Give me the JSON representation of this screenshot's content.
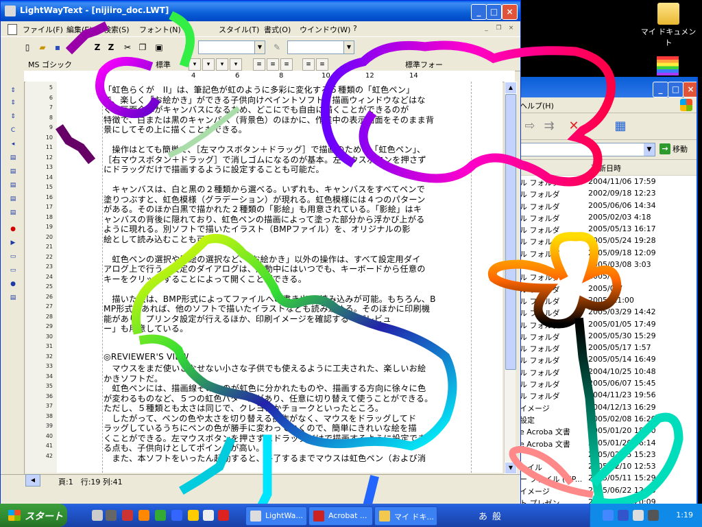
{
  "desktop": {
    "icons": [
      {
        "name": "my-documents",
        "label": "マイ ドキュメント",
        "icon": "folder-documents-icon"
      }
    ]
  },
  "editor": {
    "title": "LightWayText - [nijiiro_doc.LWT]",
    "menu": [
      "ファイル(F)",
      "編集(E)",
      "検索(S)",
      "フォント(N)",
      "",
      "スタイル(T)",
      "書式(O)",
      "ウインドウ(W)",
      "?"
    ],
    "toolbar2": {
      "font_name": "MS ゴシック",
      "style": "標準",
      "style_combo": "標準フォー"
    },
    "ruler_ticks": [
      "4",
      "6",
      "8",
      "10",
      "12",
      "14"
    ],
    "line_numbers": [
      "5",
      "6",
      "7",
      "8",
      "9",
      "10",
      "11",
      "12",
      "13",
      "14",
      "15",
      "16",
      "17",
      "18",
      "19",
      "20",
      "21",
      "22",
      "23",
      "24",
      "25",
      "26",
      "27",
      "28",
      "29",
      "30",
      "31",
      "32",
      "33",
      "34",
      "35",
      "36",
      "37",
      "38",
      "39",
      "40",
      "41",
      "42"
    ],
    "lines": [
      "「虹色らくが　II」は、筆記色が虹のように多彩に変化する５種類の「虹色ペン」",
      "で、楽しく「お絵かき」ができる子供向けペイントソフト。描画ウィンドウなどはな",
      "く、画面全体がキャンバスになるため、どこにでも自由に描くことができるのが",
      "特徴で、白または黒のキャンバス（背景色）のほかに、作業中の表示画面をそのまま背",
      "景にしてその上に描くこともできる。",
      "",
      "　操作はとても簡単で、［左マウスボタン＋ドラッグ］で描画のための「虹色ペン」、",
      "［右マウスボタン＋ドラッグ］で消しゴムになるのが基本。左マウスボタンを押さず",
      "にドラッグだけで描画するように設定することも可能だ。",
      "",
      "　キャンバスは、白と黒の２種類から選べる。いずれも、キャンバスをすべてペンで",
      "塗りつぶすと、虹色模様（グラデーション）が現れる。虹色模様には４つのパターン",
      "がある。そのほか白黒で描かれた２種類の「影絵」も用意されている。「影絵」はキ",
      "ャンバスの背後に隠れており、虹色ペンの描画によって塗った部分から浮かび上がる",
      "ように現れる。別ソフトで描いたイラスト（BMPファイル）を、オリジナルの影",
      "絵として読み込むことも可能だ。",
      "",
      "　虹色ペンの選択や影絵の選択など、「お絵かき」以外の操作は、すべて設定用ダイ",
      "アログ上で行う。設定のダイアログは、起動中にはいつでも、キーボードから任意の",
      "キーをクリックすることによって開くことができる。",
      "",
      "　描いた絵は、BMP形式によってファイルへの書き出し/読み込みが可能。もちろん、B",
      "MP形式であれば、他のソフトで描いたイラストなども読み込める。そのほかに印刷機",
      "能があり、プリンタ設定が行えるほか、印刷イメージを確認する「プレビュ",
      "ー」も用意している。",
      "",
      "",
      "◎REVIEWER'S VIEW",
      "　マウスをまだ使いこなせない小さな子供でも使えるように工夫された、楽しいお絵",
      "かきソフトだ。",
      "　虹色ペンには、描画線そのものが虹色に分かれたものや、描画する方向に徐々に色",
      "が変わるものなど、５つの虹色パターンがあり、任意に切り替えて使うことができる。",
      "ただし、５種類とも太さは同じで、クレヨンかチョークといったところ。",
      "　したがって、ペンの色や太さを切り替える操作がなく、マウスをドラッグしてド",
      "ラッグしているうちにペンの色が勝手に変わっていくので、簡単にきれいな絵を描",
      "くことができる。左マウスボタンを押さずにドラッグだけで描画するように設定でき",
      "る点も、子供向けとしてポイントが高い。",
      "　また、本ソフトをいったん起動すると、終了するまでマウスは虹色ペン（および消"
    ],
    "status": "頁:1　行:19 列:41"
  },
  "explorer": {
    "menu_help": "ヘルプ(H)",
    "go_label": "移動",
    "column_header": "更新日時",
    "rows": [
      {
        "type": "ル フォルダ",
        "date": "2004/11/06 17:59"
      },
      {
        "type": "ル フォルダ",
        "date": "2002/09/18 12:23"
      },
      {
        "type": "ル フォルダ",
        "date": "2005/06/06 14:34"
      },
      {
        "type": "ル フォルダ",
        "date": "2005/02/03 4:18"
      },
      {
        "type": "ル フォルダ",
        "date": "2005/05/13 16:17"
      },
      {
        "type": "ル フォルダ",
        "date": "2005/05/24 19:28"
      },
      {
        "type": "ル フォルダ",
        "date": "2005/09/18 12:09"
      },
      {
        "type": "",
        "date": "2005/03/08 3:03"
      },
      {
        "type": "ル フォルダ",
        "date": "2005/"
      },
      {
        "type": "ル フォルダ",
        "date": "2005/01/"
      },
      {
        "type": "ル フォルダ",
        "date": "2005/ 11:00"
      },
      {
        "type": "ル フォルダ",
        "date": "2005/03/29 14:42"
      },
      {
        "type": "ル フォルダ",
        "date": "2005/01/05 17:49"
      },
      {
        "type": "ル フォルダ",
        "date": "2005/05/30 15:29"
      },
      {
        "type": "ル フォルダ",
        "date": "2005/05/17 1:57"
      },
      {
        "type": "ル フォルダ",
        "date": "2005/05/14 16:49"
      },
      {
        "type": "ル フォルダ",
        "date": "2004/10/25 10:48"
      },
      {
        "type": "ル フォルダ",
        "date": "2005/06/07 15:45"
      },
      {
        "type": "ル フォルダ",
        "date": "2004/11/23 19:56"
      },
      {
        "type": "イメージ",
        "date": "2004/12/13 16:29"
      },
      {
        "type": "設定",
        "date": "2005/02/08 16:20"
      },
      {
        "type": "e Acroba 文書",
        "date": "2005/01/20 18:00"
      },
      {
        "type": "e Acroba 文書",
        "date": "2005/01/20 16:14"
      },
      {
        "type": "",
        "date": "2005/02/15 15:23"
      },
      {
        "type": "ァイル",
        "date": "2005/02/10 12:53"
      },
      {
        "type": "ー ファイル (MP...",
        "date": "2005/05/11 15:29"
      },
      {
        "type": "イメージ",
        "date": "2005/06/22 12:53"
      },
      {
        "type": "ト プレゼン...",
        "date": "2005/01/31 20:09"
      }
    ]
  },
  "taskbar": {
    "start_label": "スタート",
    "tasks": [
      {
        "label": "LightWa...",
        "icon": "lightway-icon"
      },
      {
        "label": "Acrobat ...",
        "icon": "acrobat-icon"
      },
      {
        "label": "マイ ドキ...",
        "icon": "folder-icon"
      }
    ],
    "ime": [
      "あ",
      "般"
    ],
    "clock": "1:19"
  },
  "colors": {
    "xp_blue": "#0a5fd8",
    "start_green": "#3b9e3b",
    "tray_blue": "#0f8ae8"
  }
}
